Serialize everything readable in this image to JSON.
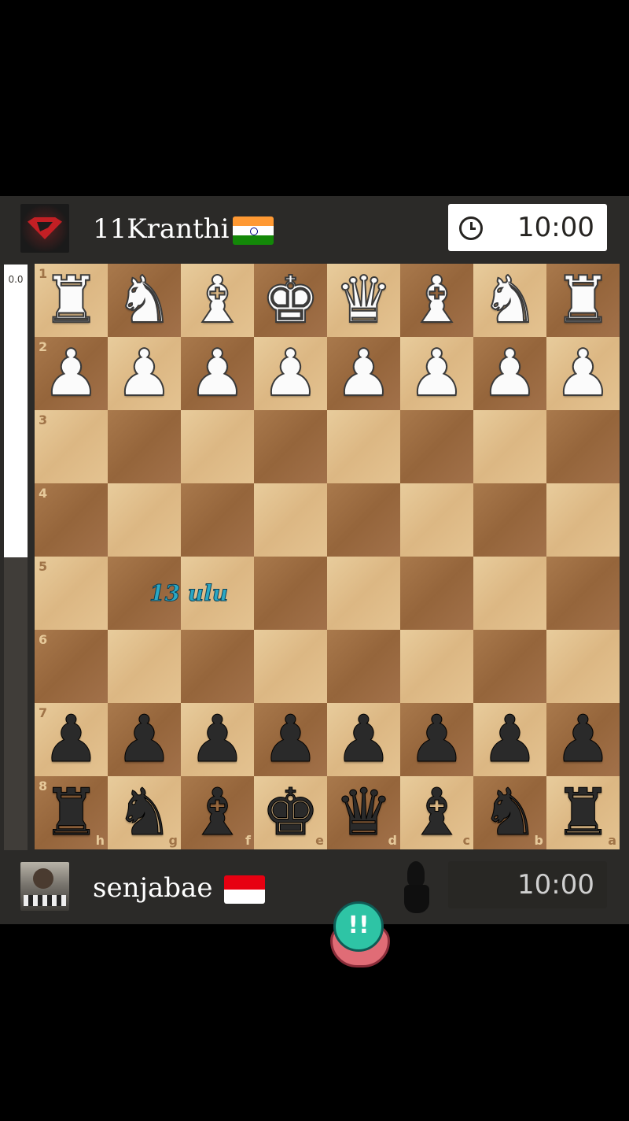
{
  "top_player": {
    "name": "11Kranthi",
    "flag": "🇮🇳",
    "avatar": "superman-logo-avatar",
    "clock": "10:00",
    "clock_icon": "clock-icon"
  },
  "bottom_player": {
    "name": "senjabae",
    "flag": "🇮🇩",
    "avatar": "player-photo-avatar",
    "clock": "10:00",
    "turn_indicator_icon": "black-pawn-icon"
  },
  "eval_bar": {
    "value": "0.0",
    "white_fraction": 0.5
  },
  "board": {
    "orientation": "black-bottom",
    "rank_labels": [
      "1",
      "2",
      "3",
      "4",
      "5",
      "6",
      "7",
      "8"
    ],
    "file_labels": [
      "h",
      "g",
      "f",
      "e",
      "d",
      "c",
      "b",
      "a"
    ],
    "rows": [
      [
        "wR",
        "wN",
        "wB",
        "wK",
        "wQ",
        "wB",
        "wN",
        "wR"
      ],
      [
        "wP",
        "wP",
        "wP",
        "wP",
        "wP",
        "wP",
        "wP",
        "wP"
      ],
      [
        "",
        "",
        "",
        "",
        "",
        "",
        "",
        ""
      ],
      [
        "",
        "",
        "",
        "",
        "",
        "",
        "",
        ""
      ],
      [
        "",
        "",
        "",
        "",
        "",
        "",
        "",
        ""
      ],
      [
        "",
        "",
        "",
        "",
        "",
        "",
        "",
        ""
      ],
      [
        "bP",
        "bP",
        "bP",
        "bP",
        "bP",
        "bP",
        "bP",
        "bP"
      ],
      [
        "bR",
        "bN",
        "bB",
        "bK",
        "bQ",
        "bB",
        "bN",
        "bR"
      ]
    ]
  },
  "overlay_text": "13 ulu",
  "reaction": {
    "icon": "exclamation-ball-sticker-icon",
    "text": "!!"
  }
}
